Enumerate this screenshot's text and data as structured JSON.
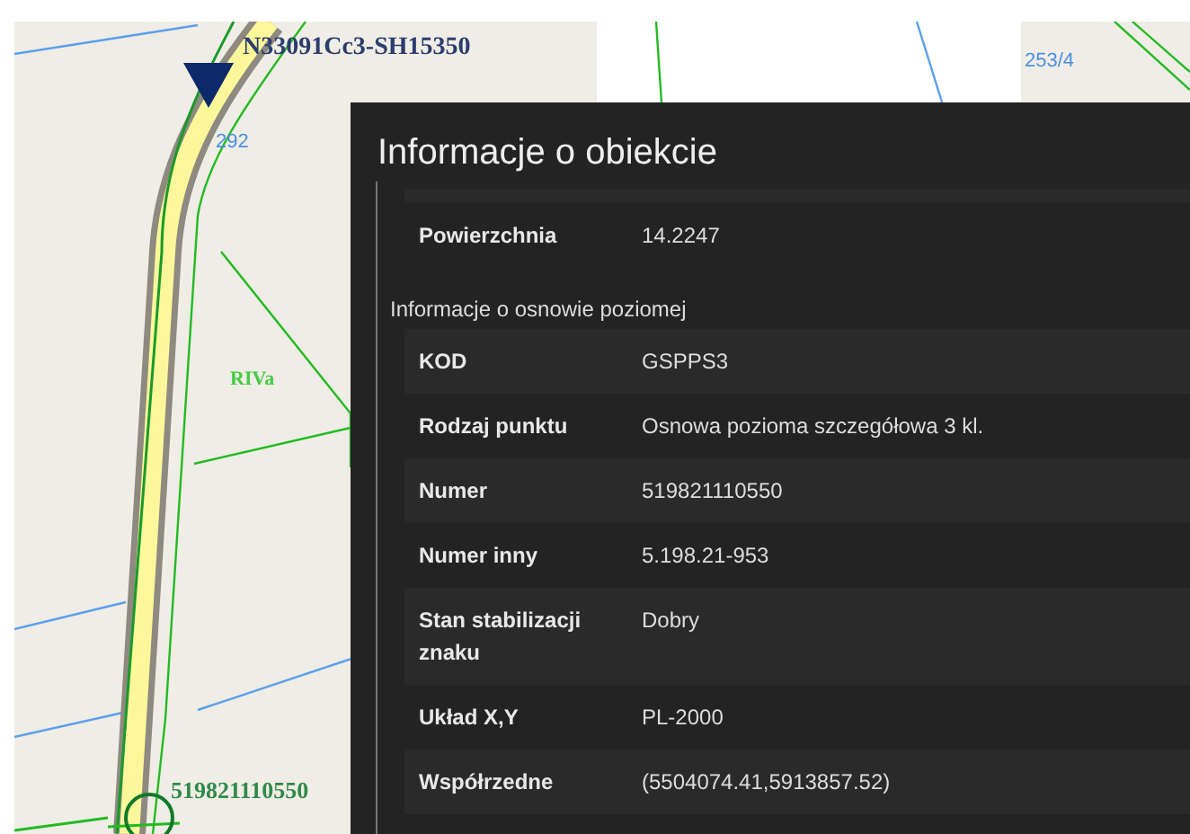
{
  "map": {
    "labels": [
      {
        "kind": "point",
        "text": "N33091Cc3-SH15350"
      },
      {
        "kind": "parcel",
        "text": "292"
      },
      {
        "kind": "parcel",
        "text": "253/4"
      },
      {
        "kind": "landuse",
        "text": "RIVa"
      },
      {
        "kind": "point-number",
        "text": "519821110550"
      }
    ]
  },
  "panel": {
    "title": "Informacje o obiekcie",
    "sections": [
      {
        "rows": [
          {
            "label": "Powierzchnia",
            "value": "14.2247"
          }
        ]
      },
      {
        "heading": "Informacje o osnowie poziomej",
        "rows": [
          {
            "label": "KOD",
            "value": "GSPPS3"
          },
          {
            "label": "Rodzaj punktu",
            "value": "Osnowa pozioma szczegółowa 3 kl."
          },
          {
            "label": "Numer",
            "value": "519821110550"
          },
          {
            "label": "Numer inny",
            "value": "5.198.21-953"
          },
          {
            "label": "Stan stabilizacji znaku",
            "value": "Dobry"
          },
          {
            "label": "Układ X,Y",
            "value": "PL-2000"
          },
          {
            "label": "Współrzedne",
            "value": "(5504074.41,5913857.52)"
          }
        ]
      }
    ]
  }
}
